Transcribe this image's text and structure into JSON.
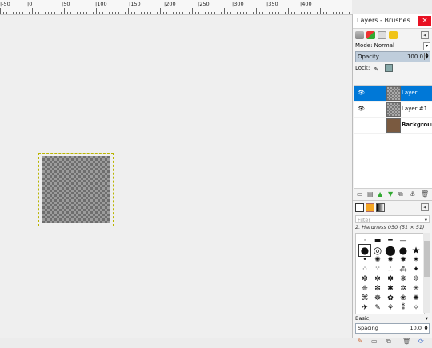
{
  "ruler": {
    "labels": [
      {
        "text": "|-50"
      },
      {
        "text": "|0"
      },
      {
        "text": "|50"
      },
      {
        "text": "|100"
      },
      {
        "text": "|150"
      },
      {
        "text": "|200"
      },
      {
        "text": "|250"
      },
      {
        "text": "|300"
      },
      {
        "text": "|350"
      },
      {
        "text": "|400"
      }
    ]
  },
  "dock": {
    "title": "Layers - Brushes",
    "close_label": "×",
    "mode_label": "Mode: Normal",
    "opacity_label": "Opacity",
    "opacity_value": "100.0",
    "lock_label": "Lock:",
    "layers": [
      {
        "name": "Layer",
        "selected": true,
        "visible": true
      },
      {
        "name": "Layer #1",
        "selected": false,
        "visible": true
      },
      {
        "name": "Background",
        "selected": false,
        "visible": false
      }
    ],
    "filter_placeholder": "Filter",
    "brush_name": "2. Hardness 050 (51 × 51)",
    "brush_preset": "Basic,",
    "spacing_label": "Spacing",
    "spacing_value": "10.0"
  },
  "colors": {
    "selection_blue": "#0078d7",
    "close_red": "#e81123"
  }
}
